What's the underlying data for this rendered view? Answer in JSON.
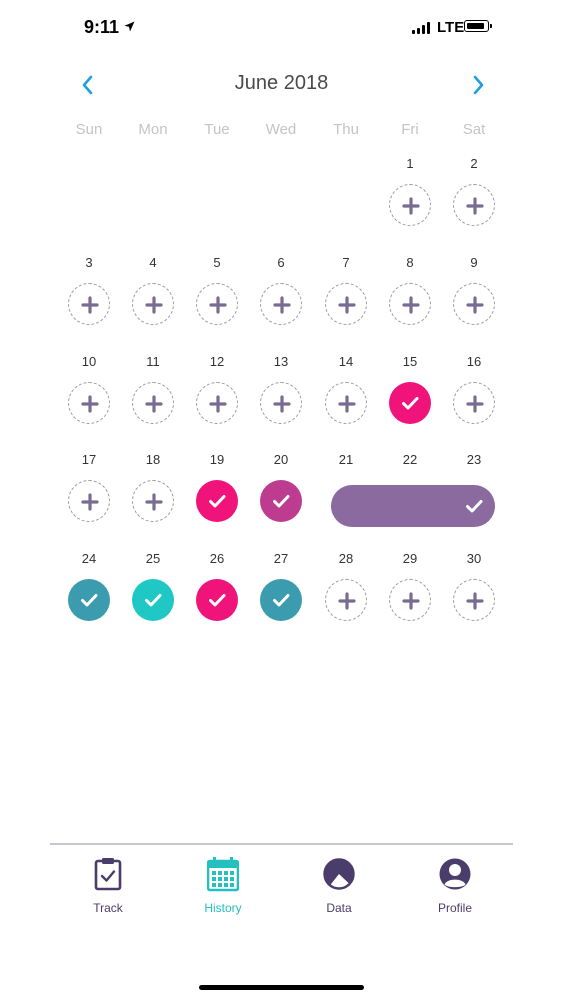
{
  "status_bar": {
    "time": "9:11",
    "network": "LTE"
  },
  "calendar": {
    "month_label": "June 2018",
    "weekdays": [
      "Sun",
      "Mon",
      "Tue",
      "Wed",
      "Thu",
      "Fri",
      "Sat"
    ],
    "days": [
      {
        "day": "1",
        "status": "empty"
      },
      {
        "day": "2",
        "status": "empty"
      },
      {
        "day": "3",
        "status": "empty"
      },
      {
        "day": "4",
        "status": "empty"
      },
      {
        "day": "5",
        "status": "empty"
      },
      {
        "day": "6",
        "status": "empty"
      },
      {
        "day": "7",
        "status": "empty"
      },
      {
        "day": "8",
        "status": "empty"
      },
      {
        "day": "9",
        "status": "empty"
      },
      {
        "day": "10",
        "status": "empty"
      },
      {
        "day": "11",
        "status": "empty"
      },
      {
        "day": "12",
        "status": "empty"
      },
      {
        "day": "13",
        "status": "empty"
      },
      {
        "day": "14",
        "status": "empty"
      },
      {
        "day": "15",
        "status": "magenta"
      },
      {
        "day": "16",
        "status": "empty"
      },
      {
        "day": "17",
        "status": "empty"
      },
      {
        "day": "18",
        "status": "empty"
      },
      {
        "day": "19",
        "status": "magenta"
      },
      {
        "day": "20",
        "status": "plum"
      },
      {
        "day": "21",
        "status": "purple-range"
      },
      {
        "day": "22",
        "status": "purple-range"
      },
      {
        "day": "23",
        "status": "purple-range"
      },
      {
        "day": "24",
        "status": "teal"
      },
      {
        "day": "25",
        "status": "aqua"
      },
      {
        "day": "26",
        "status": "magenta"
      },
      {
        "day": "27",
        "status": "teal"
      },
      {
        "day": "28",
        "status": "empty"
      },
      {
        "day": "29",
        "status": "empty"
      },
      {
        "day": "30",
        "status": "empty"
      }
    ]
  },
  "colors": {
    "magenta": "#f0137a",
    "plum": "#bd3c8f",
    "purple-range": "#8a6a9f",
    "teal": "#3a9cae",
    "aqua": "#1fc8c4",
    "plus": "#7a6b93",
    "nav_arrow": "#1ea0e0",
    "tab_active": "#24c0bf",
    "tab_inactive": "#4b3d6b"
  },
  "tab_bar": {
    "tabs": [
      {
        "label": "Track",
        "icon": "clipboard-check-icon",
        "active": false
      },
      {
        "label": "History",
        "icon": "calendar-icon",
        "active": true
      },
      {
        "label": "Data",
        "icon": "pie-chart-icon",
        "active": false
      },
      {
        "label": "Profile",
        "icon": "person-icon",
        "active": false
      }
    ]
  }
}
